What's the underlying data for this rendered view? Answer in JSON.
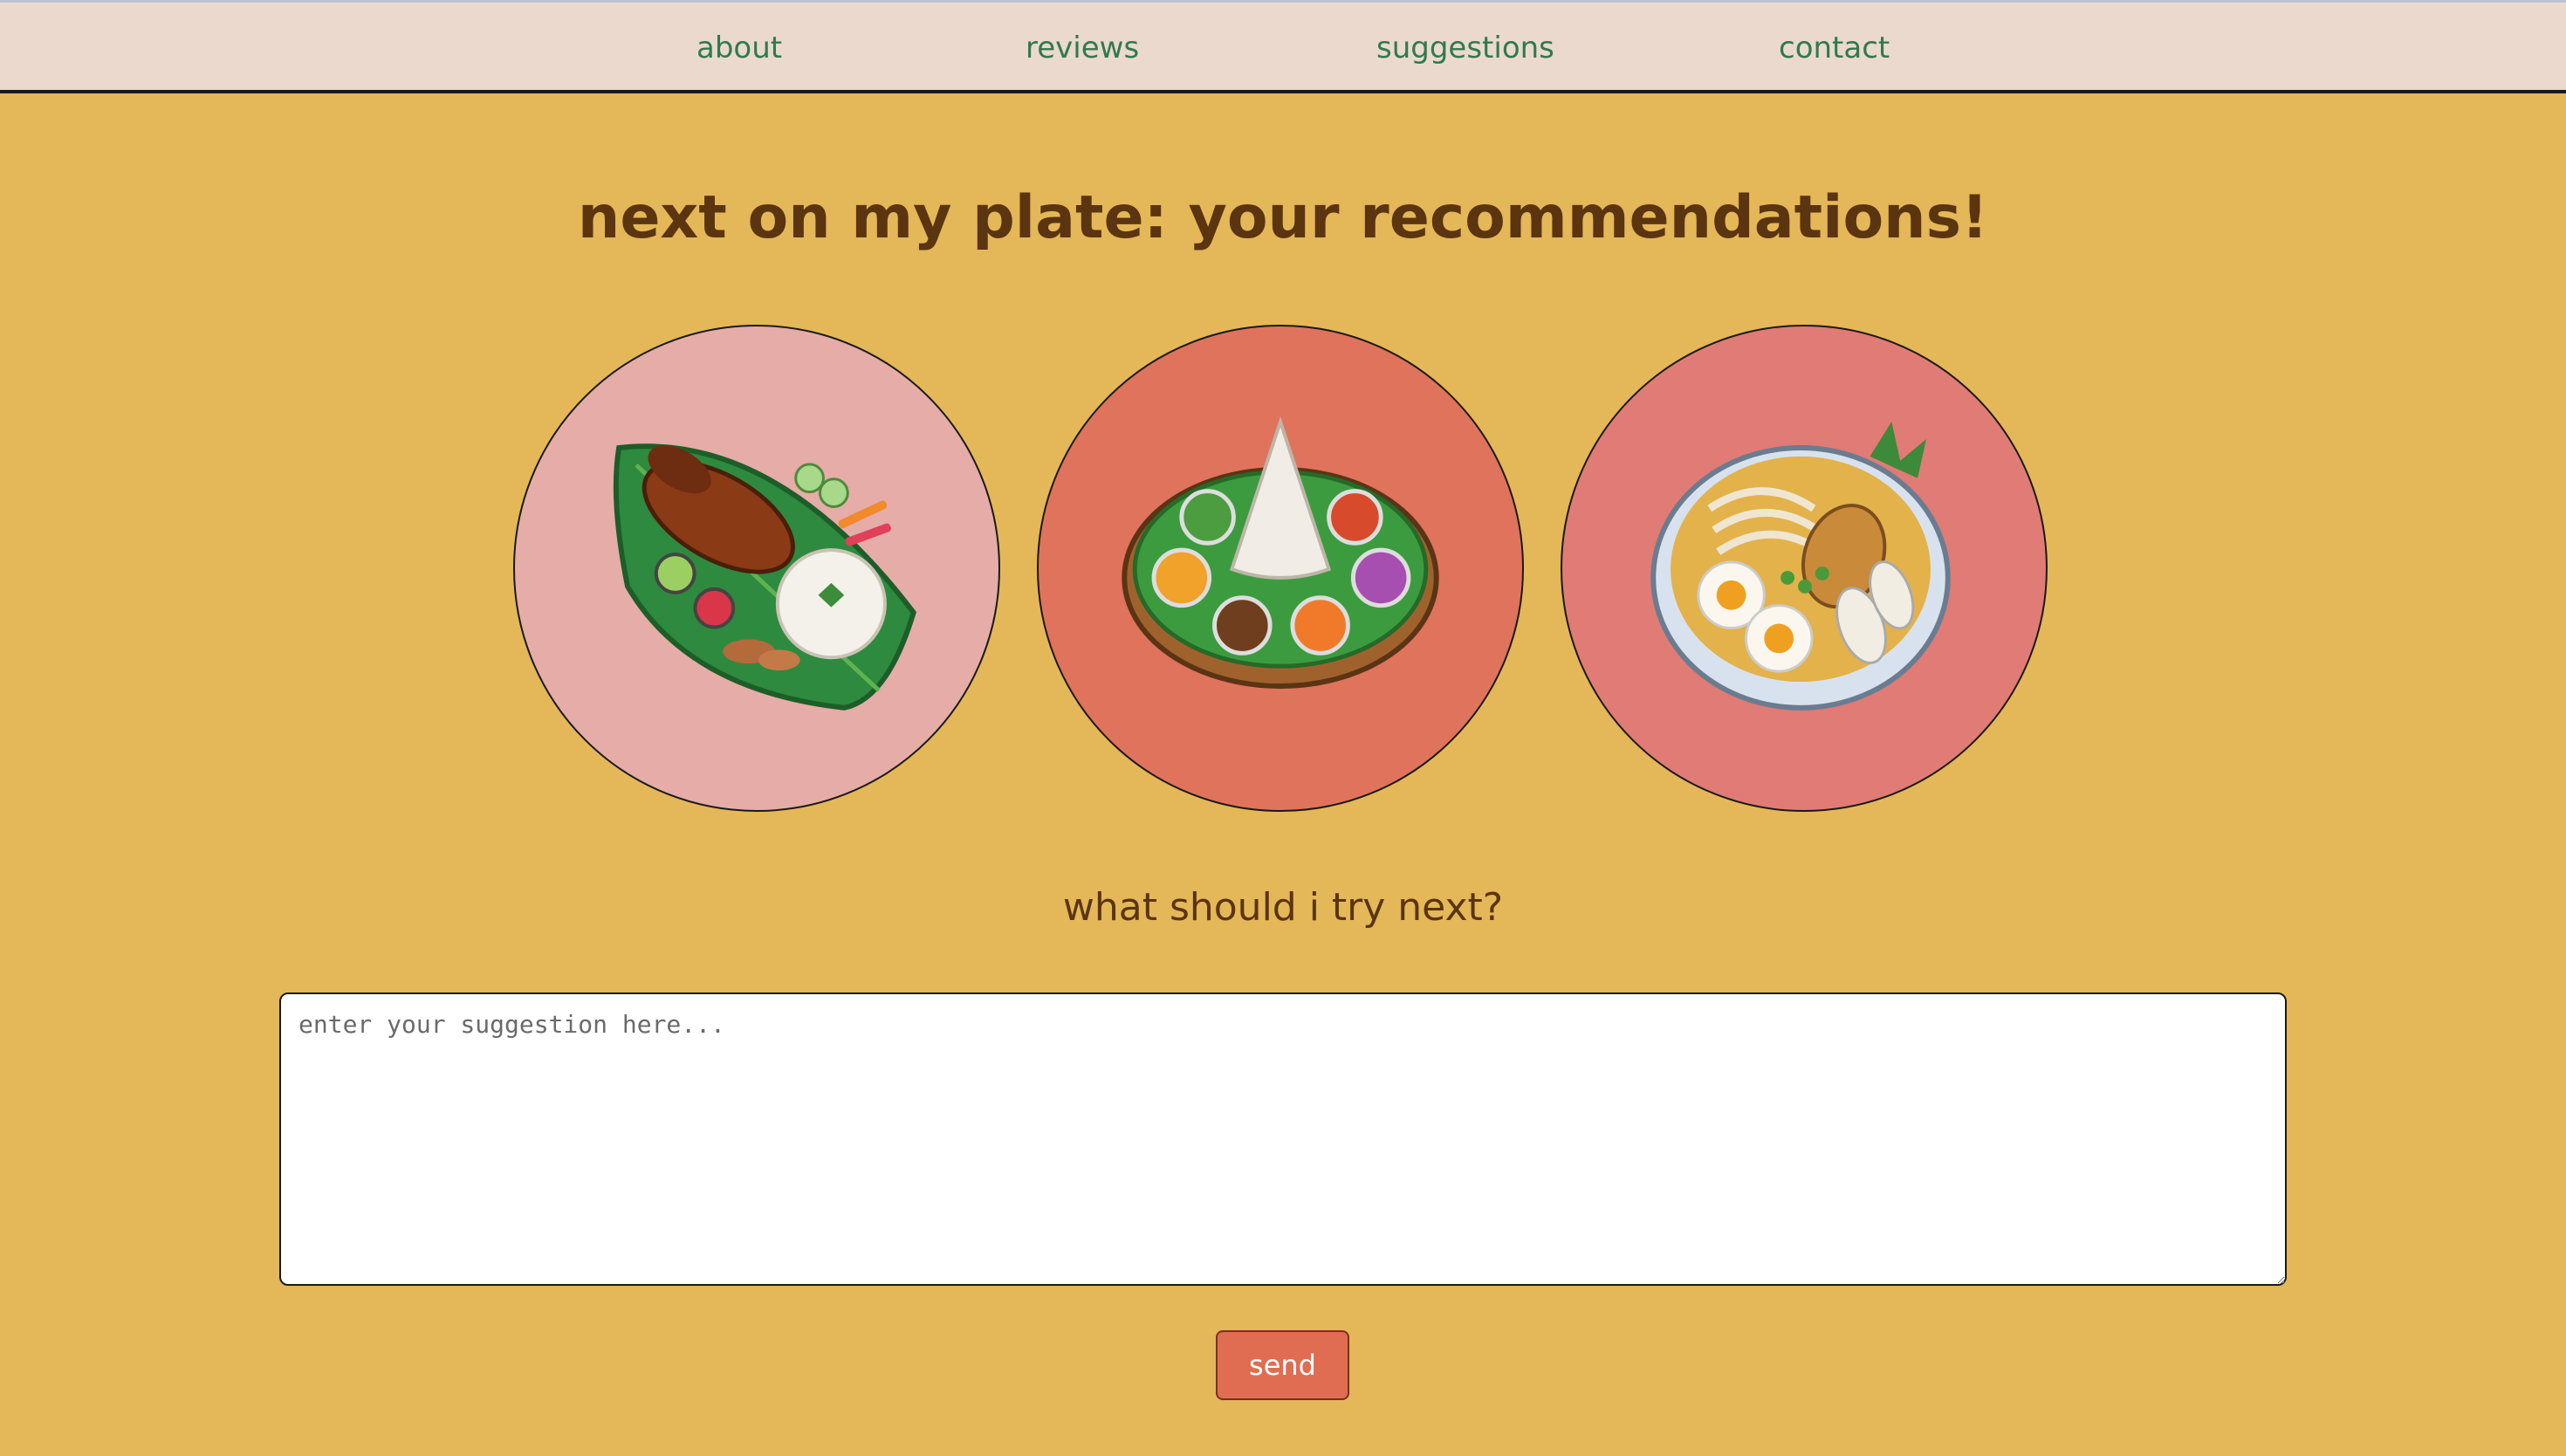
{
  "nav": {
    "items": [
      {
        "label": "about"
      },
      {
        "label": "reviews"
      },
      {
        "label": "suggestions"
      },
      {
        "label": "contact"
      }
    ]
  },
  "page_title": "next on my plate: your recommendations!",
  "plates": [
    {
      "dish": "grilled-chicken-rice-on-leaf",
      "bg": "#e5aca8"
    },
    {
      "dish": "rice-cone-platter",
      "bg": "#e0735c"
    },
    {
      "dish": "noodle-soup-bowl",
      "bg": "#e07b76"
    }
  ],
  "prompt": "what should i try next?",
  "suggestion": {
    "value": "",
    "placeholder": "enter your suggestion here..."
  },
  "send_label": "send",
  "colors": {
    "background": "#e4b758",
    "nav_bg": "#ecd9cd",
    "nav_text": "#2f7a4f",
    "heading": "#5b3510",
    "button": "#e06c52"
  }
}
